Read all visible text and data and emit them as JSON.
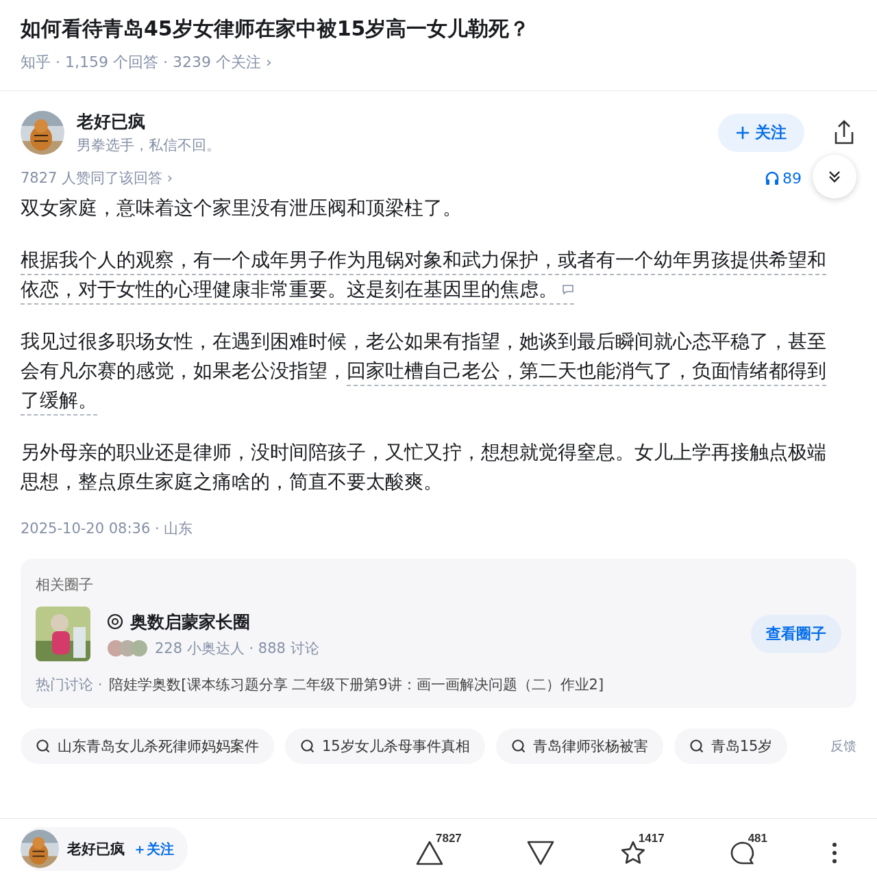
{
  "question": {
    "title": "如何看待青岛45岁女律师在家中被15岁高一女儿勒死？",
    "meta": "知乎 · 1,159 个回答 · 3239 个关注 ›"
  },
  "author": {
    "name": "老好已疯",
    "bio": "男拳选手，私信不回。",
    "follow": "关注",
    "following": false
  },
  "answer": {
    "votes_line": "7827 人赞同了该回答 ›",
    "listen_count": "89",
    "paragraphs": [
      [
        {
          "text": "双女家庭，意味着这个家里没有泄压阀和顶梁柱了。",
          "underlined": false
        }
      ],
      [
        {
          "text": "根据我个人的观察，有一个成年男子作为甩锅对象和武力保护，或者有一个幼年男孩提供希望和依恋，对于女性的心理健康非常重要。这是刻在基因里的焦虑。",
          "underlined": true,
          "comment": true
        }
      ],
      [
        {
          "text": "我见过很多职场女性，在遇到困难时候，老公如果有指望，她谈到最后瞬间就心态平稳了，甚至会有凡尔赛的感觉，如果老公没指望，",
          "underlined": false
        },
        {
          "text": "回家吐槽自己老公，第二天也能消气了，负面情绪都得到了缓解。",
          "underlined": true
        }
      ],
      [
        {
          "text": "另外母亲的职业还是律师，没时间陪孩子，又忙又拧，想想就觉得窒息。女儿上学再接触点极端思想，整点原生家庭之痛啥的，简直不要太酸爽。",
          "underlined": false
        }
      ]
    ],
    "time": "2025-10-20 08:36 · 山东"
  },
  "circle": {
    "heading": "相关圈子",
    "name": "奥数启蒙家长圈",
    "stats": "228 小奥达人 · 888 讨论",
    "button": "查看圈子",
    "hot_label": "热门讨论 ·",
    "hot_topic": "陪娃学奥数[课本练习题分享 二年级下册第9讲：画一画解决问题（二）作业2]"
  },
  "searches": [
    "山东青岛女儿杀死律师妈妈案件",
    "15岁女儿杀母事件真相",
    "青岛律师张杨被害",
    "青岛15岁"
  ],
  "feedback": "反馈",
  "bottom_bar": {
    "name": "老好已疯",
    "follow": "＋关注",
    "upvotes": "7827",
    "favorites": "1417",
    "comments": "481"
  }
}
